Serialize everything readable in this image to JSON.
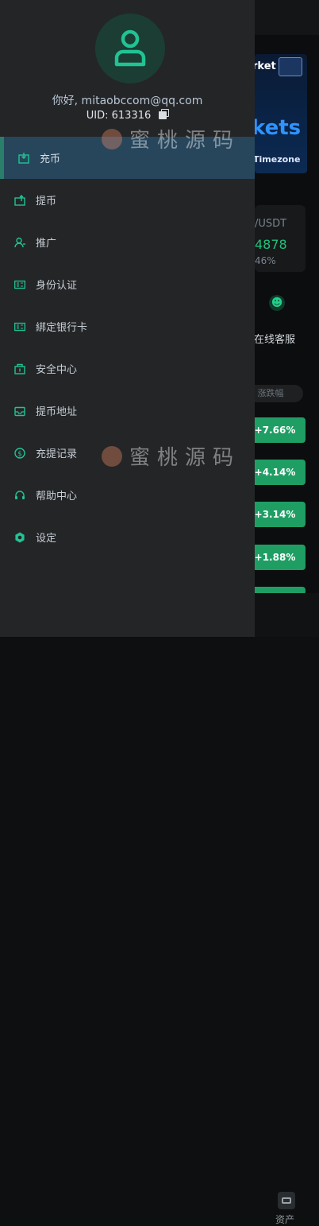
{
  "background": {
    "banner": {
      "line1": "rket",
      "line2": "kets",
      "line3": "Timezone"
    },
    "ticker": {
      "pair": "/USDT",
      "price": "4878",
      "change": "46%"
    },
    "customer_service_label": "在线客服",
    "sort_tab_label": "涨跌幅",
    "gains": [
      "+7.66%",
      "+4.14%",
      "+3.14%",
      "+1.88%"
    ],
    "bottom_nav": {
      "assets_label": "资产"
    }
  },
  "drawer": {
    "greeting": "你好, mitaobccom@qq.com",
    "uid": "UID: 613316",
    "menu": [
      {
        "label": "充币",
        "icon": "deposit-icon",
        "active": true
      },
      {
        "label": "提币",
        "icon": "withdraw-icon",
        "active": false
      },
      {
        "label": "推广",
        "icon": "promote-icon",
        "active": false
      },
      {
        "label": "身份认证",
        "icon": "id-card-icon",
        "active": false
      },
      {
        "label": "綁定银行卡",
        "icon": "bank-card-icon",
        "active": false
      },
      {
        "label": "安全中心",
        "icon": "security-icon",
        "active": false
      },
      {
        "label": "提币地址",
        "icon": "address-icon",
        "active": false
      },
      {
        "label": "充提记录",
        "icon": "records-icon",
        "active": false
      },
      {
        "label": "帮助中心",
        "icon": "headset-icon",
        "active": false
      },
      {
        "label": "设定",
        "icon": "settings-icon",
        "active": false
      }
    ]
  },
  "watermark": "蜜桃源码",
  "colors": {
    "accent": "#21c393",
    "drawer_bg": "#242527",
    "active_bg": "#27465c",
    "gain_green": "#1f9e64"
  }
}
